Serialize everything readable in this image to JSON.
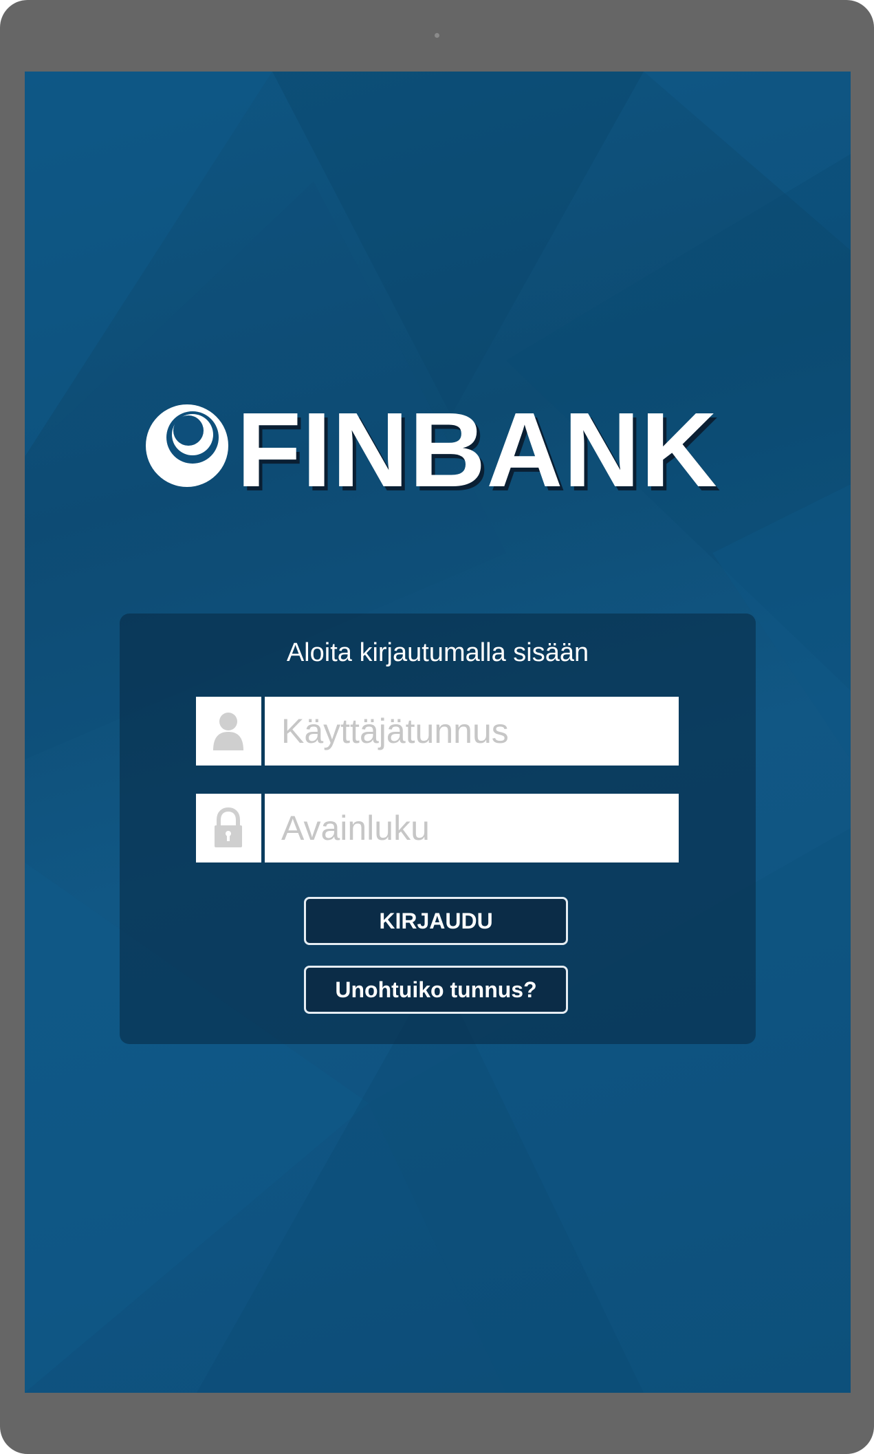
{
  "brand": {
    "name": "FINBANK",
    "logo_icon": "crescent-circle-logo"
  },
  "login": {
    "title": "Aloita kirjautumalla sisään",
    "username": {
      "icon": "user-icon",
      "placeholder": "Käyttäjätunnus",
      "value": ""
    },
    "password": {
      "icon": "lock-icon",
      "placeholder": "Avainluku",
      "value": ""
    },
    "submit_label": "KIRJAUDU",
    "forgot_label": "Unohtuiko tunnus?"
  },
  "colors": {
    "background": "#0f5683",
    "panel": "#0b3455",
    "button": "#0b2c47",
    "device_frame": "#666666",
    "placeholder": "#c6c6c6"
  }
}
